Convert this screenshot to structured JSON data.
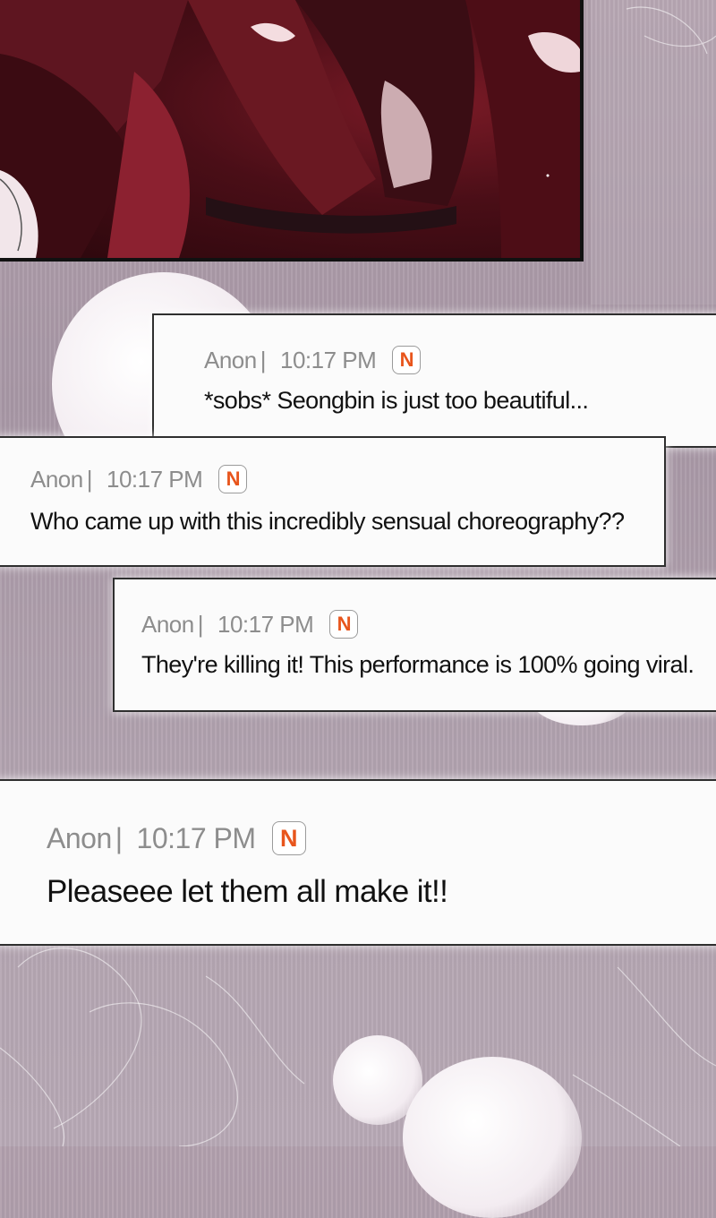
{
  "comments": [
    {
      "author": "Anon",
      "separator": "|",
      "time": "10:17 PM",
      "badge": "N",
      "text": "*sobs* Seongbin is just too beautiful..."
    },
    {
      "author": "Anon",
      "separator": "|",
      "time": "10:17 PM",
      "badge": "N",
      "text": "Who came up with this incredibly sensual choreography??"
    },
    {
      "author": "Anon",
      "separator": "|",
      "time": "10:17 PM",
      "badge": "N",
      "text": "They're killing it! This performance is 100% going viral."
    },
    {
      "author": "Anon",
      "separator": "|",
      "time": "10:17 PM",
      "badge": "N",
      "text": "Pleaseee let them all make it!!"
    }
  ],
  "colors": {
    "badge_letter": "#e8551c",
    "meta_text": "#8d8d8d",
    "panel_red": "#7a1a26"
  },
  "icons": {
    "badge": "n-badge-icon"
  }
}
